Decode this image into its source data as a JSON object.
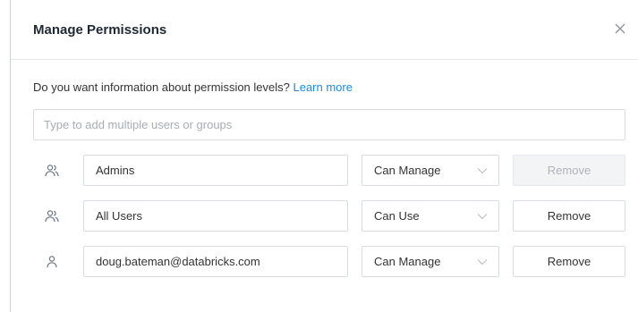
{
  "dialog": {
    "title": "Manage Permissions",
    "close_icon": "close-icon"
  },
  "info": {
    "text": "Do you want information about permission levels? ",
    "link": "Learn more"
  },
  "add_field": {
    "placeholder": "Type to add multiple users or groups",
    "value": ""
  },
  "permissions": [
    {
      "icon": "group-icon",
      "name": "Admins",
      "level": "Can Manage",
      "remove_label": "Remove",
      "remove_disabled": true
    },
    {
      "icon": "group-icon",
      "name": "All Users",
      "level": "Can Use",
      "remove_label": "Remove",
      "remove_disabled": false
    },
    {
      "icon": "user-icon",
      "name": "doug.bateman@databricks.com",
      "level": "Can Manage",
      "remove_label": "Remove",
      "remove_disabled": false
    }
  ],
  "colors": {
    "link": "#1a8cdb",
    "border": "#d9dde1",
    "disabled_bg": "#f3f4f5",
    "icon": "#6b7580"
  }
}
